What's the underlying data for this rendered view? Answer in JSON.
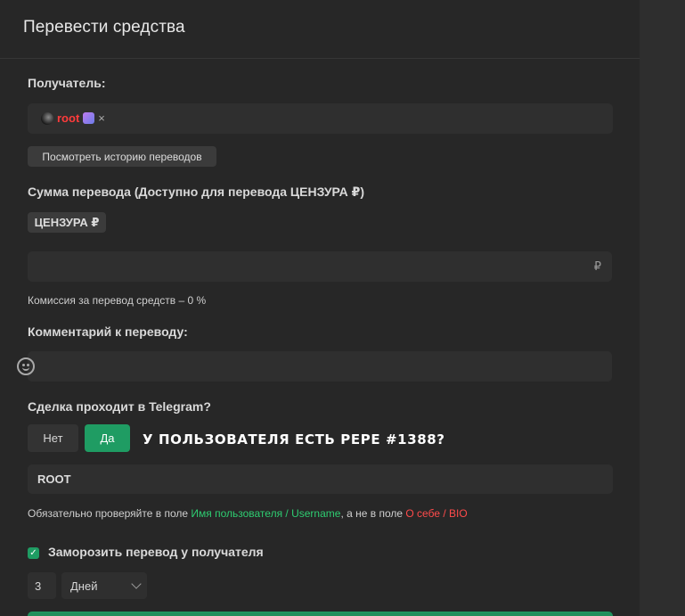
{
  "modal": {
    "title": "Перевести средства"
  },
  "recipient": {
    "label": "Получатель:",
    "username": "root",
    "username_color": "#ff3b3b",
    "remove_icon": "×",
    "history_button": "Посмотреть историю переводов"
  },
  "amount": {
    "label": "Сумма перевода (Доступно для перевода ЦЕНЗУРА ₽)",
    "balance_chip": "ЦЕНЗУРА ₽",
    "value": "",
    "currency": "₽",
    "commission": "Комиссия за перевод средств – 0 %"
  },
  "comment": {
    "label": "Комментарий к переводу:",
    "value": "",
    "emoji_icon": "smile-icon"
  },
  "telegram": {
    "label": "Сделка проходит в Telegram?",
    "no_label": "Нет",
    "yes_label": "Да",
    "selected": "Да",
    "overlay_text": "У ПОЛЬЗОВАТЕЛЯ ЕСТЬ PEPE #1388?",
    "username_value": "ROOT",
    "hint_prefix": "Обязательно проверяйте в поле ",
    "hint_green": "Имя пользователя / Username",
    "hint_middle": ", а не в поле ",
    "hint_red": "О себе / BIO",
    "accent_green": "#2ecc71",
    "accent_red": "#ff4b4b"
  },
  "freeze": {
    "label": "Заморозить перевод у получателя",
    "checked": true,
    "duration_value": "3",
    "duration_unit": "Дней"
  },
  "colors": {
    "primary": "#1f9c63",
    "background": "#272727"
  }
}
